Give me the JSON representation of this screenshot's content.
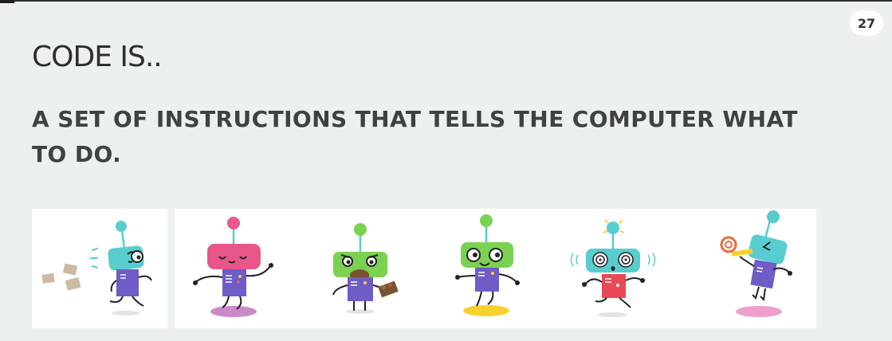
{
  "slide": {
    "page_number": "27",
    "title": "CODE IS..",
    "subtitle": "A SET OF INSTRUCTIONS THAT TELLS THE COMPUTER WHAT TO DO."
  },
  "illustrations": [
    {
      "name": "robot-running-papers",
      "icon": "robot-running-icon"
    },
    {
      "name": "robot-dancing-pink",
      "icon": "robot-dancing-icon"
    },
    {
      "name": "robot-eating-chocolate",
      "icon": "robot-eating-icon"
    },
    {
      "name": "robot-walking-green",
      "icon": "robot-walking-icon"
    },
    {
      "name": "robot-dizzy",
      "icon": "robot-dizzy-icon"
    },
    {
      "name": "robot-party-horn",
      "icon": "robot-party-icon"
    }
  ],
  "colors": {
    "background": "#edf0f0",
    "card": "#ffffff",
    "title": "#2c2e30",
    "subtitle": "#3f4244",
    "robot_body": "#6f5cc6",
    "teal": "#58cdd0",
    "pink": "#e8578a",
    "green": "#7bd151",
    "red": "#e94857",
    "yellow": "#f8d22c"
  }
}
